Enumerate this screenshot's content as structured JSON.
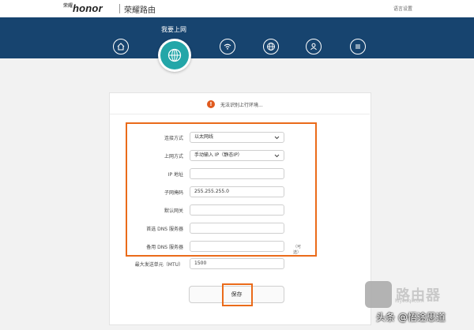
{
  "header": {
    "brand_mark": "荣耀",
    "brand_logo": "honor",
    "product_title": "荣耀路由",
    "language_link": "语言设置"
  },
  "nav": {
    "current_label": "我要上网",
    "items": [
      "home-icon",
      "internet-icon",
      "wifi-icon",
      "network-icon",
      "user-icon",
      "menu-icon"
    ]
  },
  "alert": {
    "icon_text": "!",
    "text": "无法识别上行环境..."
  },
  "form": {
    "fields": [
      {
        "label": "连接方式",
        "value": "以太网线",
        "type": "select"
      },
      {
        "label": "上网方式",
        "value": "手动输入 IP（静态IP）",
        "type": "select"
      },
      {
        "label": "IP 地址",
        "value": "",
        "type": "input"
      },
      {
        "label": "子网掩码",
        "value": "255.255.255.0",
        "type": "input"
      },
      {
        "label": "默认网关",
        "value": "",
        "type": "input"
      },
      {
        "label": "首选 DNS 服务器",
        "value": "",
        "type": "input"
      },
      {
        "label": "备用 DNS 服务器",
        "value": "",
        "type": "input",
        "hint": "（可选）"
      },
      {
        "label": "最大发送单元（MTU）",
        "value": "1500",
        "type": "input"
      }
    ],
    "save_label": "保存"
  },
  "watermark": {
    "left_text": "头条 @悟途思道",
    "right_text": "路由器",
    "right_url": "luyouqi.com"
  },
  "colors": {
    "nav_bg": "#17446f",
    "accent_teal": "#23a6a8",
    "highlight_orange": "#ea6b1a",
    "alert_red": "#e05a1e"
  }
}
